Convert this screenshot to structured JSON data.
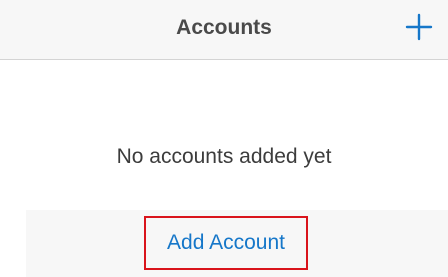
{
  "navbar": {
    "title": "Accounts",
    "add_icon": "plus-icon",
    "accent_color": "#1677c9"
  },
  "main": {
    "empty_message": "No accounts added yet",
    "add_account_label": "Add Account",
    "highlight_color": "#d9141b"
  }
}
